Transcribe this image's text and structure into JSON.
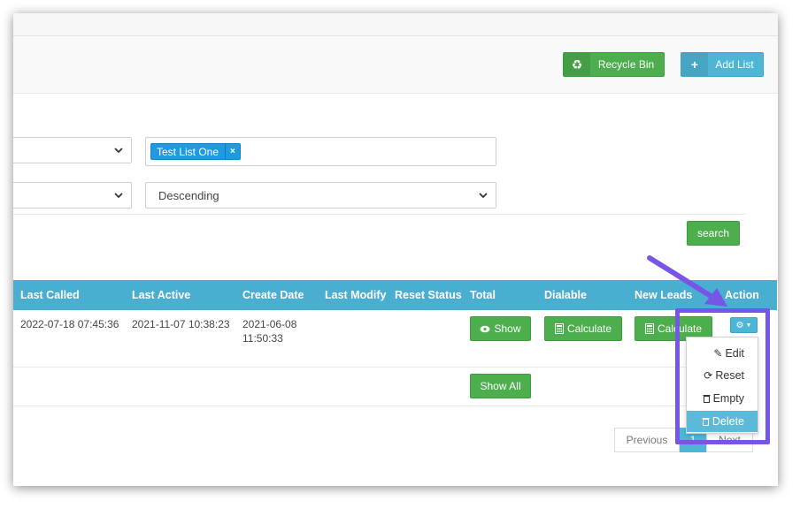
{
  "header": {
    "recycle_bin_label": "Recycle Bin",
    "add_list_label": "Add List"
  },
  "filters": {
    "selected_tags": [
      "Test List One"
    ],
    "tag_remove_glyph": "×",
    "sort_order": "Descending",
    "search_label": "search"
  },
  "table": {
    "columns": [
      "Last Called",
      "Last Active",
      "Create Date",
      "Last Modify",
      "Reset Status",
      "Total",
      "Dialable",
      "New Leads",
      "Action"
    ],
    "rows": [
      {
        "last_called": "2022-07-18 07:45:36",
        "last_active": "2021-11-07 10:38:23",
        "create_date_line1": "2021-06-08",
        "create_date_line2": "11:50:33",
        "last_modify": "",
        "reset_status": "",
        "show_label": "Show",
        "calculate_label": "Calculate",
        "new_leads_label": "Calculate"
      }
    ],
    "show_all_label": "Show All"
  },
  "action_menu": {
    "items": [
      {
        "label": "Edit",
        "icon": "pencil-icon"
      },
      {
        "label": "Reset",
        "icon": "refresh-icon"
      },
      {
        "label": "Empty",
        "icon": "trash-icon"
      },
      {
        "label": "Delete",
        "icon": "trash-icon"
      }
    ]
  },
  "pagination": {
    "previous_label": "Previous",
    "current_page": "1",
    "next_label": "Next"
  },
  "colors": {
    "header_blue": "#4aaed0",
    "button_green": "#4cae4c",
    "button_blue": "#4db6d7",
    "tag_blue": "#1e9be0",
    "annotation_purple": "#7755e6"
  }
}
